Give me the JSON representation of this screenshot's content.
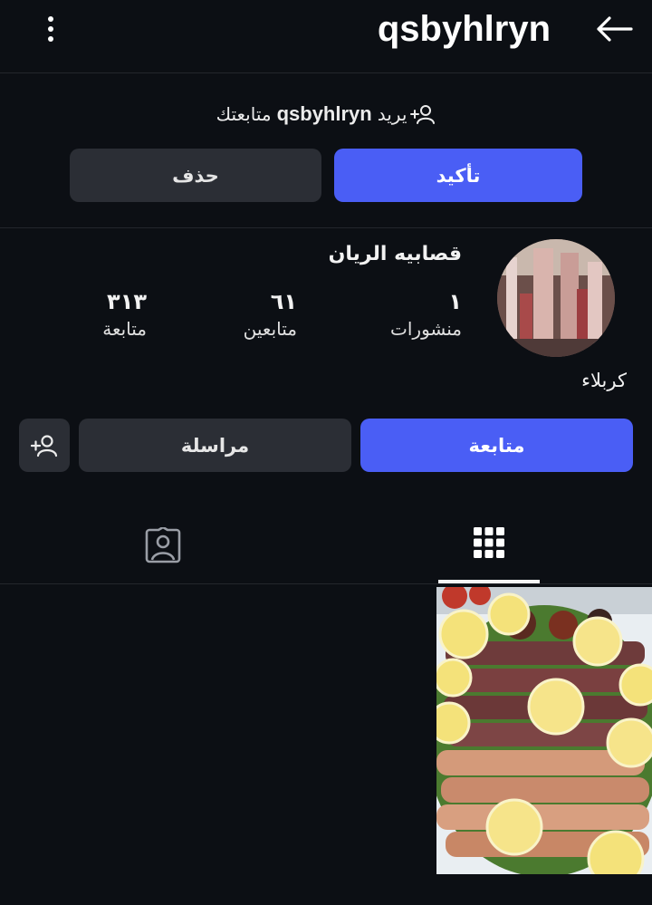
{
  "header": {
    "username": "qsbyhlryn"
  },
  "follow_request": {
    "prefix": "يريد",
    "username": "qsbyhlryn",
    "suffix": "متابعتك",
    "confirm_label": "تأكيد",
    "delete_label": "حذف"
  },
  "profile": {
    "display_name": "قصابيه الريان",
    "stats": {
      "posts_count": "١",
      "posts_label": "منشورات",
      "followers_count": "٦١",
      "followers_label": "متابعين",
      "following_count": "٣١٣",
      "following_label": "متابعة"
    },
    "bio": "كربلاء"
  },
  "actions": {
    "follow_label": "متابعة",
    "message_label": "مراسلة"
  },
  "tabs": {
    "active": "grid"
  },
  "colors": {
    "background": "#0c0f14",
    "primary": "#4a5ef5",
    "secondary": "#2b2e35"
  }
}
